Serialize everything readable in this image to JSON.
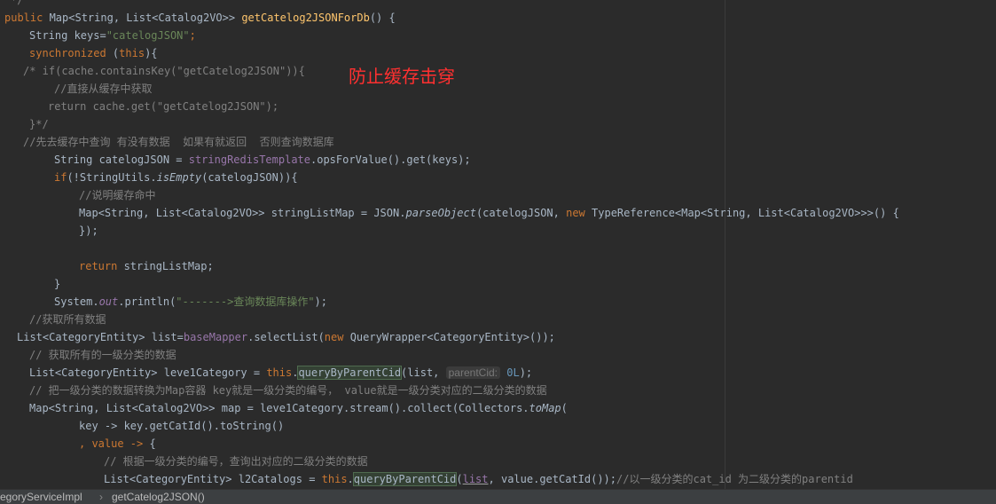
{
  "annotation": "防止缓存击穿",
  "code": {
    "l0": "*/",
    "l1": {
      "a": "public ",
      "b": "Map<String, List<Catalog2VO>> ",
      "c": "getCatelog2JSONForDb",
      "d": "() {"
    },
    "l2": {
      "a": "String keys=",
      "b": "\"catelogJSON\"",
      "c": ";"
    },
    "l3": {
      "a": "synchronized ",
      "b": "(",
      "c": "this",
      "d": "){"
    },
    "l4": "/* if(cache.containsKey(\"getCatelog2JSON\")){",
    "l5": "//直接从缓存中获取",
    "l6": "return cache.get(\"getCatelog2JSON\");",
    "l7": "}*/",
    "l8": "//先去缓存中查询 有没有数据  如果有就返回  否则查询数据库",
    "l9": {
      "a": "String catelogJSON = ",
      "b": "stringRedisTemplate",
      "c": ".opsForValue().get(keys);"
    },
    "l10": {
      "a": "if",
      "b": "(!StringUtils.",
      "c": "isEmpty",
      "d": "(catelogJSON)){"
    },
    "l11": "//说明缓存命中",
    "l12": {
      "a": "Map<String, List<Catalog2VO>> stringListMap = JSON.",
      "b": "parseObject",
      "c": "(catelogJSON, ",
      "d": "new ",
      "e": "TypeReference<Map<String, List<Catalog2VO>>>() {"
    },
    "l13": "});",
    "l15": {
      "a": "return ",
      "b": "stringListMap;"
    },
    "l16": "}",
    "l17": {
      "a": "System.",
      "b": "out",
      "c": ".println(",
      "d": "\"------->查询数据库操作\"",
      "e": ");"
    },
    "l18": "//获取所有数据",
    "l19": {
      "a": "List<CategoryEntity> list=",
      "b": "baseMapper",
      "c": ".selectList(",
      "d": "new ",
      "e": "QueryWrapper<CategoryEntity>());"
    },
    "l20": "// 获取所有的一级分类的数据",
    "l21": {
      "a": "List<CategoryEntity> leve1Category = ",
      "b": "this",
      "c": ".",
      "d": "queryByParentCid",
      "e": "(list, ",
      "f": "parentCid:",
      "g": " 0L",
      "h": ");"
    },
    "l22": {
      "a": "// 把一级分类的数据转换为Map容器 key就是一级分类的编号，",
      "b": "value就是一级分类对应的二级分类的数据"
    },
    "l23": {
      "a": "Map<String, List<Catalog2VO>> map = leve1Category.stream().collect(Collectors.",
      "b": "toMap",
      "c": "("
    },
    "l24": "key -> key.getCatId().toString()",
    "l25": {
      "a": ", value -> ",
      "b": "{"
    },
    "l26": "// 根据一级分类的编号，查询出对应的二级分类的数据",
    "l27": {
      "a": "List<CategoryEntity> l2Catalogs = ",
      "b": "this",
      "c": ".",
      "d": "queryByParentCid",
      "e": "(",
      "f": "list",
      "g": ", value.getCatId());",
      "h": "//以一级分类的cat_id 为二级分类的parentid"
    }
  },
  "breadcrumb": {
    "class_name": "egoryServiceImpl",
    "separator": "›",
    "method": "getCatelog2JSON()"
  }
}
